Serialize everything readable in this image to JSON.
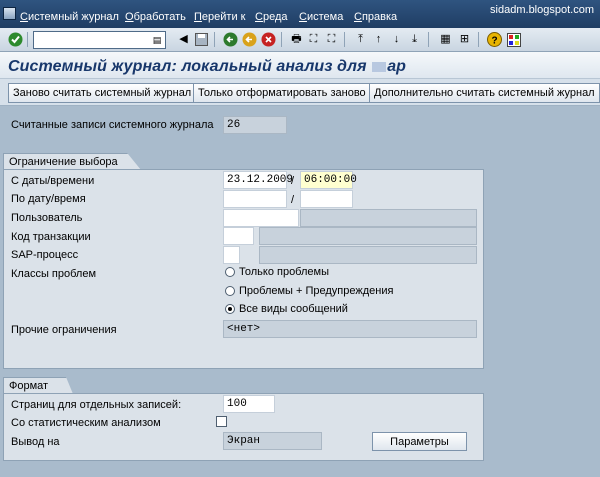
{
  "menubar": {
    "items": [
      "Системный журнал",
      "Обработать",
      "Перейти к",
      "Среда",
      "Система",
      "Справка"
    ],
    "watermark": "sidadm.blogspot.com"
  },
  "toolbar": {
    "command_field_value": "",
    "icons": [
      "enter-icon",
      "back-icon",
      "exit-icon",
      "cancel-icon",
      "save-icon",
      "print-icon",
      "find-icon",
      "find-next-icon",
      "first-page-icon",
      "prev-page-icon",
      "next-page-icon",
      "last-page-icon",
      "create-session-icon",
      "shortcut-icon",
      "help-icon",
      "customize-icon"
    ]
  },
  "title": {
    "prefix": "Системный журнал: локальный анализ для",
    "suffix": "ар"
  },
  "app_toolbar": {
    "btn_reread": "Заново считать системный журнал",
    "btn_reformat": "Только отформатировать заново",
    "btn_read_more": "Дополнительно считать системный журнал"
  },
  "summary": {
    "label": "Считанные записи системного журнала",
    "value": "26"
  },
  "selection": {
    "group_title": "Ограничение выбора",
    "from_label": "С даты/времени",
    "from_date": "23.12.2009",
    "from_time": "06:00:00",
    "to_label": "По дату/время",
    "to_date": "",
    "to_time": "",
    "slash": "/",
    "user_label": "Пользователь",
    "user_value": "",
    "tcode_label": "Код транзакции",
    "tcode_value": "",
    "sap_label": "SAP-процесс",
    "sap_value": "",
    "classes_label": "Классы проблем",
    "radio_only_problems": "Только проблемы",
    "radio_problems_warnings": "Проблемы + Предупреждения",
    "radio_all": "Все виды сообщений",
    "other_label": "Прочие ограничения",
    "other_value": "<нет>"
  },
  "format": {
    "group_title": "Формат",
    "pages_label": "Страниц для отдельных записей:",
    "pages_value": "100",
    "stat_label": "Со статистическим анализом",
    "output_label": "Вывод на",
    "output_value": "Экран",
    "params_button": "Параметры"
  }
}
